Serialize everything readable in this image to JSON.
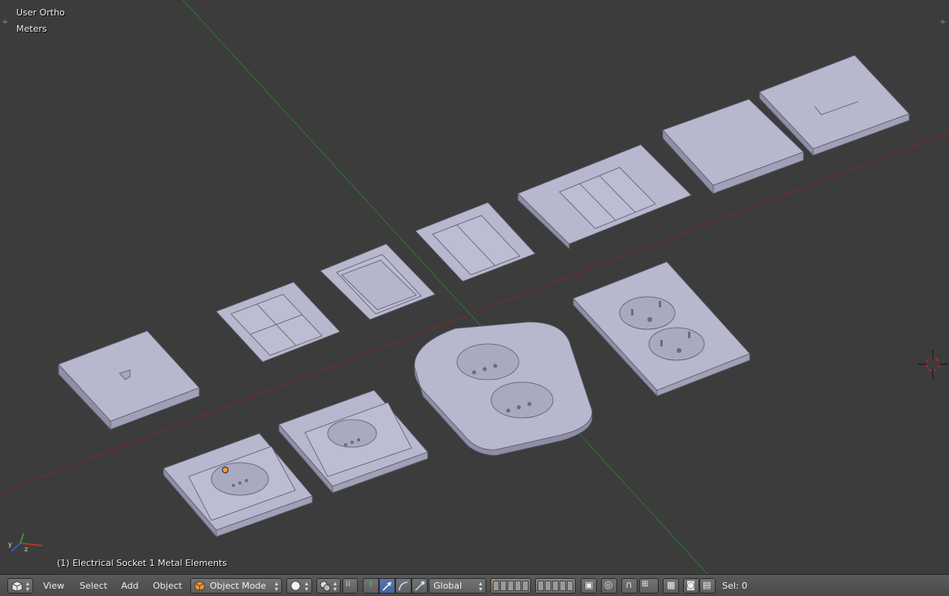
{
  "viewport": {
    "view_name": "User Ortho",
    "units": "Meters",
    "active_object": "(1) Electrical Socket 1 Metal Elements"
  },
  "header": {
    "menus": [
      "View",
      "Select",
      "Add",
      "Object"
    ],
    "mode": "Object Mode",
    "orientation": "Global",
    "sel": "Sel: 0"
  },
  "colors": {
    "background": "#3c3c3c",
    "model": "#b9b9cf",
    "x_axis": "#8a2626",
    "y_axis": "#2a7a2a"
  },
  "icons": {
    "editor_type": "cube-icon",
    "mode": "orange-cube-icon",
    "shading": "solid-sphere-icon",
    "pivot": "pivot-icon",
    "manipulator": [
      "manipulator-toggle-icon",
      "translate-icon",
      "rotate-icon",
      "scale-icon"
    ],
    "cursor": "3d-cursor-icon"
  }
}
